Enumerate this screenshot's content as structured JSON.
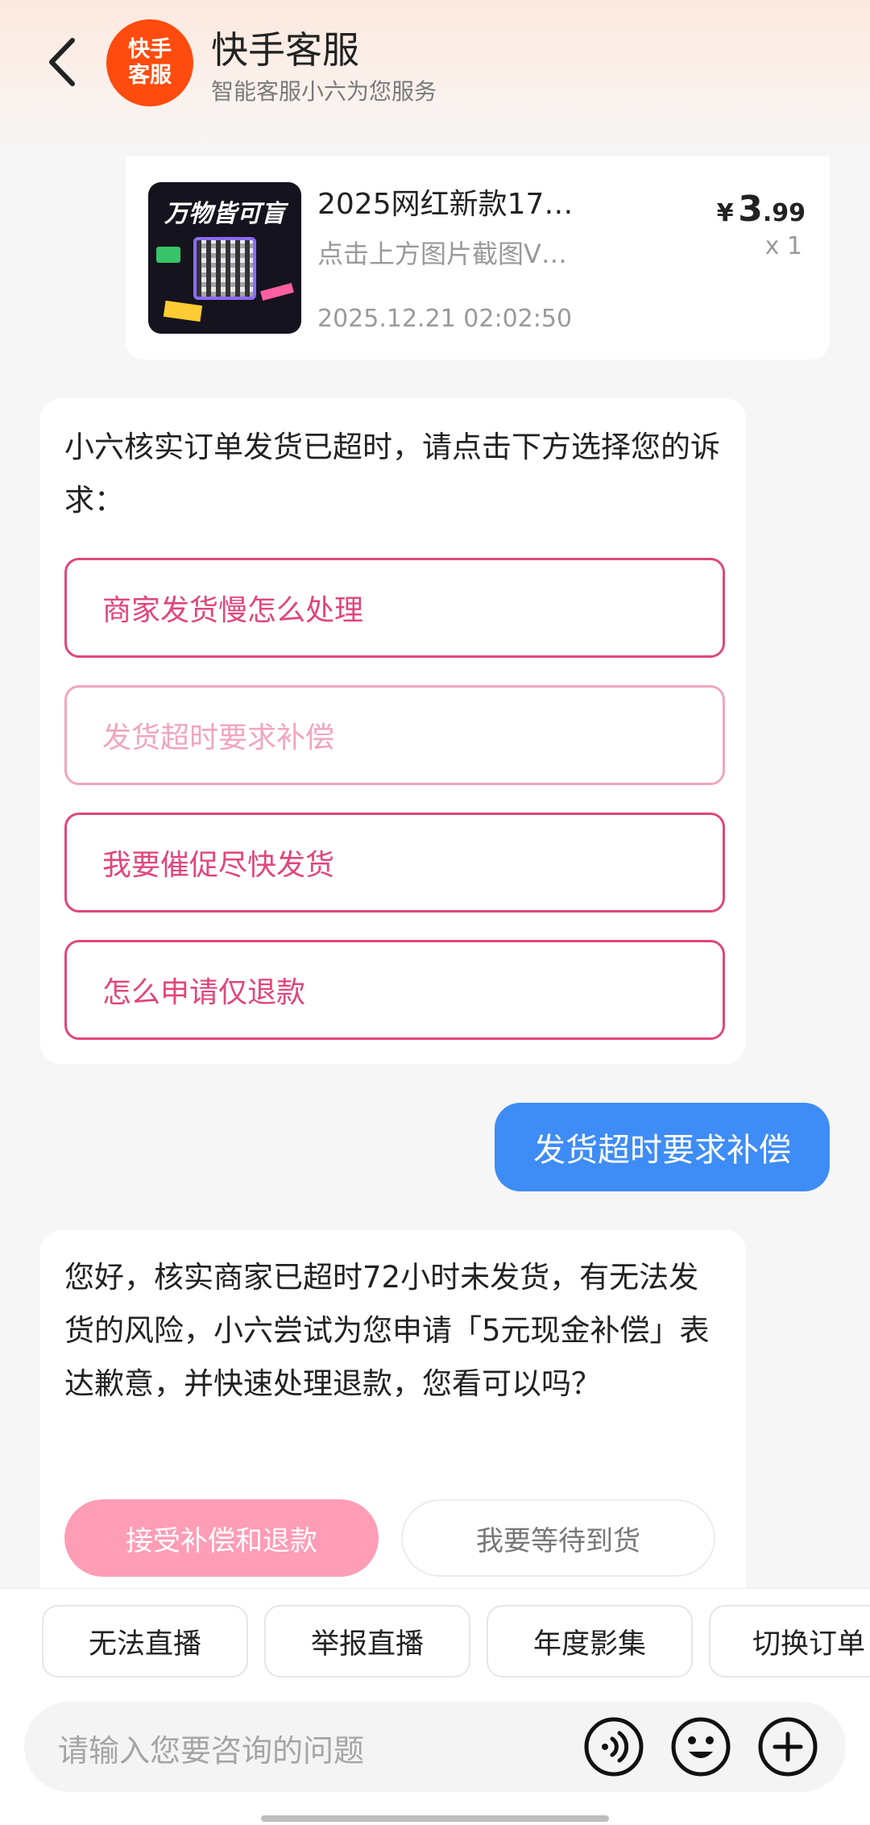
{
  "header": {
    "logo_line1": "快手",
    "logo_line2": "客服",
    "title": "快手客服",
    "subtitle": "智能客服小六为您服务"
  },
  "product": {
    "image_text": "万物皆可盲",
    "name": "2025网红新款17…",
    "description": "点击上方图片截图V…",
    "date": "2025.12.21 02:02:50",
    "price_currency": "¥",
    "price_integer": "3",
    "price_decimal": ".99",
    "quantity": "x 1"
  },
  "message1": {
    "text": "小六核实订单发货已超时，请点击下方选择您的诉求：",
    "options": [
      {
        "label": "商家发货慢怎么处理"
      },
      {
        "label": "发货超时要求补偿"
      },
      {
        "label": "我要催促尽快发货"
      },
      {
        "label": "怎么申请仅退款"
      }
    ]
  },
  "user_message": {
    "text": "发货超时要求补偿"
  },
  "message2": {
    "text": "您好，核实商家已超时72小时未发货，有无法发货的风险，小六尝试为您申请「5元现金补偿」表达歉意，并快速处理退款，您看可以吗？",
    "accept_label": "接受补偿和退款",
    "wait_label": "我要等待到货"
  },
  "quick_chips": [
    {
      "label": "无法直播"
    },
    {
      "label": "举报直播"
    },
    {
      "label": "年度影集"
    },
    {
      "label": "切换订单"
    }
  ],
  "input": {
    "placeholder": "请输入您要咨询的问题"
  },
  "icons": {
    "back": "chevron-left-icon",
    "voice": "voice-icon",
    "emoji": "emoji-icon",
    "plus": "plus-icon"
  },
  "colors": {
    "brand_orange": "#ff4b0d",
    "option_pink": "#e0467d",
    "user_bubble_blue": "#3e8cf5",
    "accept_pink": "#ff9db6"
  }
}
